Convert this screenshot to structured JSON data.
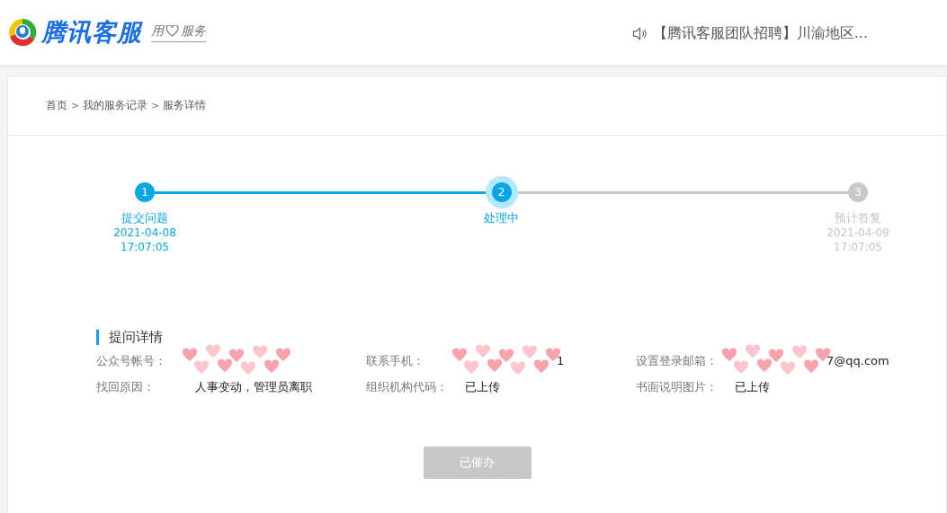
{
  "header": {
    "brand": "腾讯客服",
    "slogan": [
      "用",
      "服务"
    ],
    "notice": "【腾讯客服团队招聘】川渝地区..."
  },
  "breadcrumb": [
    {
      "kind": "link",
      "text": "首页"
    },
    {
      "kind": "separator",
      "text": ">"
    },
    {
      "kind": "link",
      "text": "我的服务记录"
    },
    {
      "kind": "separator",
      "text": ">"
    },
    {
      "kind": "current",
      "text": "服务详情"
    }
  ],
  "steps": [
    {
      "number": "1",
      "label": "提交问题",
      "date": "2021-04-08",
      "time": "17:07:05",
      "reached": true,
      "selected": false
    },
    {
      "number": "2",
      "label": "处理中",
      "reached": true,
      "selected": true
    },
    {
      "number": "3",
      "label": "预计答复",
      "date": "2021-04-09",
      "time": "17:07:05",
      "reached": false,
      "selected": false
    }
  ],
  "details": {
    "title": "提问详情",
    "fields": [
      {
        "label": "公众号帐号：",
        "redacted": true
      },
      {
        "label": "联系手机：",
        "value": "1",
        "redacted": true
      },
      {
        "label": "设置登录邮箱：",
        "value": "7@qq.com",
        "redacted": true
      },
      {
        "label": "找回原因：",
        "value": "人事变动，管理员离职",
        "redacted": false
      },
      {
        "label": "组织机构代码：",
        "value": "已上传",
        "redacted": false
      },
      {
        "label": "书面说明图片：",
        "value": "已上传",
        "redacted": false
      }
    ]
  },
  "action": {
    "label": "已催办",
    "disabled": true
  }
}
